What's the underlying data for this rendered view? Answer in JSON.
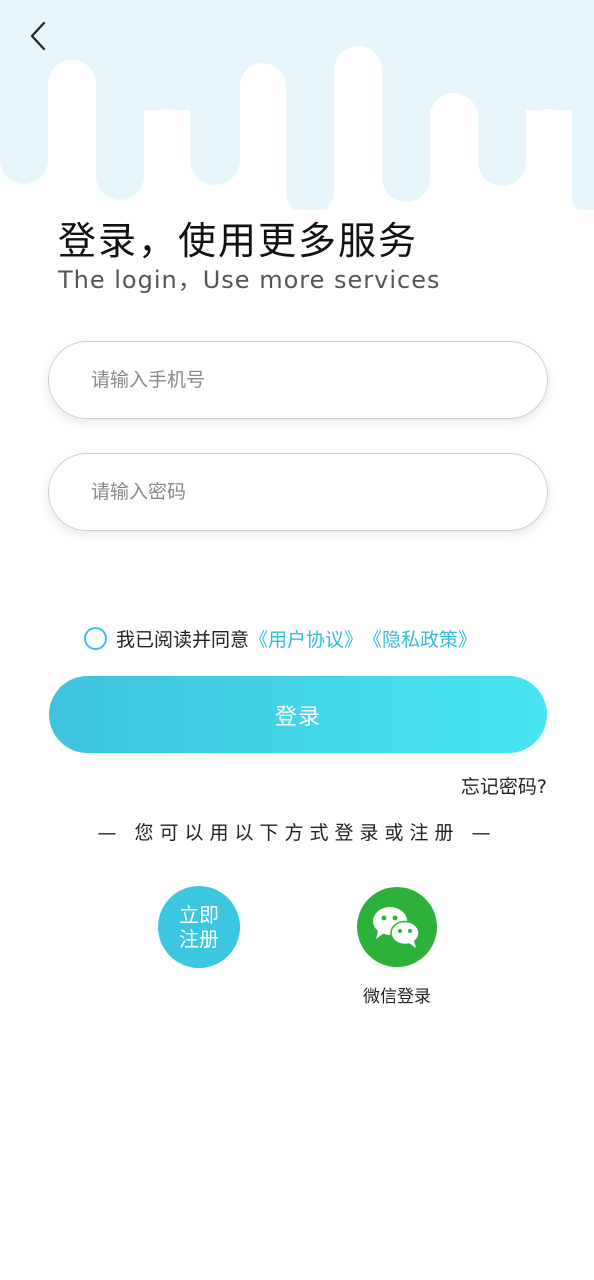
{
  "header": {
    "back_icon": "chevron-left-icon",
    "bg_color": "#e6f6fb"
  },
  "title": {
    "cn": "登录，使用更多服务",
    "en": "The login，Use more services"
  },
  "form": {
    "phone_placeholder": "请输入手机号",
    "phone_value": "",
    "password_placeholder": "请输入密码",
    "password_value": ""
  },
  "agreement": {
    "text": "我已阅读并同意",
    "user_agreement": "《用户协议》",
    "privacy_policy": "《隐私政策》",
    "checked": false
  },
  "login_button": "登录",
  "forgot_password": "忘记密码?",
  "alt_login_text": "— 您可以用以下方式登录或注册 —",
  "register": {
    "line1": "立即",
    "line2": "注册"
  },
  "wechat": {
    "icon": "wechat-icon",
    "label": "微信登录"
  },
  "colors": {
    "accent": "#3cc6e0",
    "gradient_end": "#48e6f2",
    "wechat_green": "#2eb13b"
  }
}
